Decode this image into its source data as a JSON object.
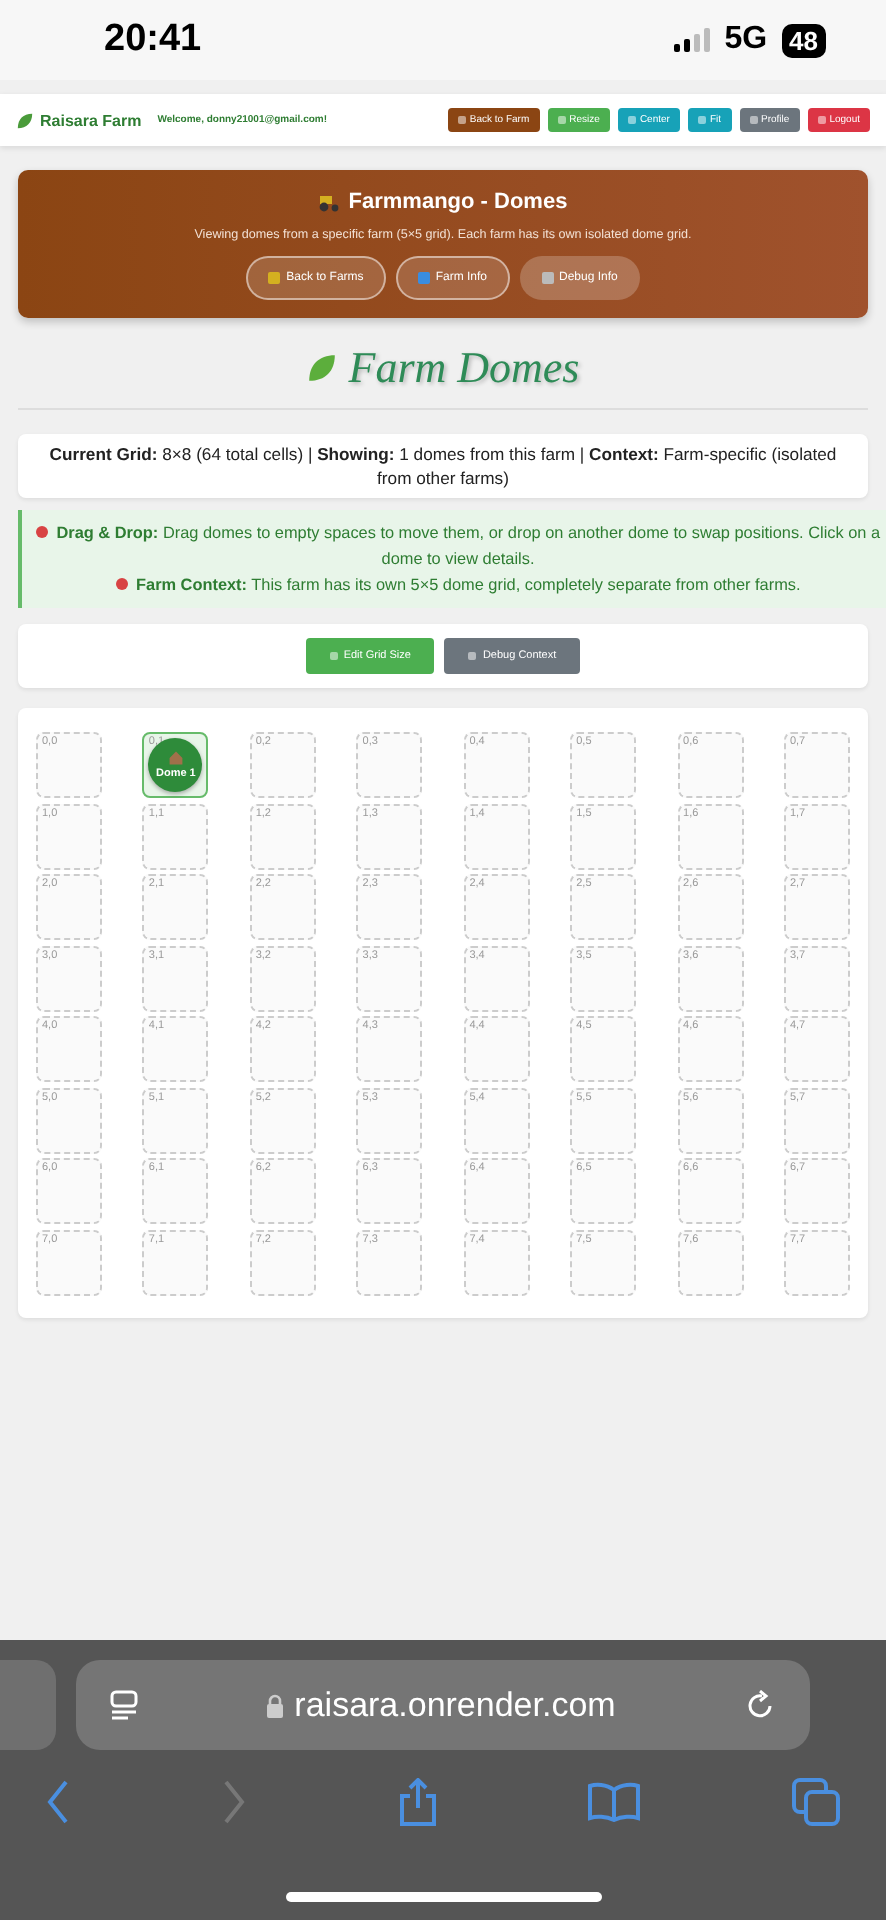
{
  "status_bar": {
    "time": "20:41",
    "network": "5G",
    "battery": "48"
  },
  "nav": {
    "brand": "Raisara Farm",
    "welcome": "Welcome, donny21001@gmail.com!",
    "buttons": [
      {
        "label": "Back to Farm",
        "kind": "brown"
      },
      {
        "label": "Resize",
        "kind": "green"
      },
      {
        "label": "Center",
        "kind": "teal"
      },
      {
        "label": "Fit",
        "kind": "teal"
      },
      {
        "label": "Profile",
        "kind": "grey"
      },
      {
        "label": "Logout",
        "kind": "red"
      }
    ]
  },
  "header": {
    "title": "Farmmango - Domes",
    "subtitle": "Viewing domes from a specific farm (5×5 grid). Each farm has its own isolated dome grid.",
    "buttons": [
      {
        "label": "Back to Farms"
      },
      {
        "label": "Farm Info"
      },
      {
        "label": "Debug Info"
      }
    ]
  },
  "page_title": "Farm Domes",
  "info": "**Current Grid:** 8×8 (64 total cells) | **Showing:** 1 domes from this farm | **Context:** Farm-specific (isolated from other farms)",
  "notes": [
    "**Drag & Drop:** Drag domes to empty spaces to move them, or drop on another dome to swap positions. Click on a dome to view details.",
    "**Farm Context:** This farm has its own 5×5 dome grid, completely separate from other farms."
  ],
  "actions": [
    {
      "label": "Edit Grid Size",
      "kind": "green"
    },
    {
      "label": "Debug Context",
      "kind": "grey"
    }
  ],
  "grid": {
    "rows": [
      [
        {
          "label": "0,0"
        },
        {
          "label": "0,1",
          "dome": "Dome 1"
        },
        {
          "label": "0,2"
        },
        {
          "label": "0,3"
        },
        {
          "label": "0,4"
        },
        {
          "label": "0,5"
        },
        {
          "label": "0,6"
        },
        {
          "label": "0,7"
        }
      ],
      [
        {
          "label": "1,0"
        },
        {
          "label": "1,1"
        },
        {
          "label": "1,2"
        },
        {
          "label": "1,3"
        },
        {
          "label": "1,4"
        },
        {
          "label": "1,5"
        },
        {
          "label": "1,6"
        },
        {
          "label": "1,7"
        }
      ],
      [
        {
          "label": "2,0"
        },
        {
          "label": "2,1"
        },
        {
          "label": "2,2"
        },
        {
          "label": "2,3"
        },
        {
          "label": "2,4"
        },
        {
          "label": "2,5"
        },
        {
          "label": "2,6"
        },
        {
          "label": "2,7"
        }
      ],
      [
        {
          "label": "3,0"
        },
        {
          "label": "3,1"
        },
        {
          "label": "3,2"
        },
        {
          "label": "3,3"
        },
        {
          "label": "3,4"
        },
        {
          "label": "3,5"
        },
        {
          "label": "3,6"
        },
        {
          "label": "3,7"
        }
      ],
      [
        {
          "label": "4,0"
        },
        {
          "label": "4,1"
        },
        {
          "label": "4,2"
        },
        {
          "label": "4,3"
        },
        {
          "label": "4,4"
        },
        {
          "label": "4,5"
        },
        {
          "label": "4,6"
        },
        {
          "label": "4,7"
        }
      ],
      [
        {
          "label": "5,0"
        },
        {
          "label": "5,1"
        },
        {
          "label": "5,2"
        },
        {
          "label": "5,3"
        },
        {
          "label": "5,4"
        },
        {
          "label": "5,5"
        },
        {
          "label": "5,6"
        },
        {
          "label": "5,7"
        }
      ],
      [
        {
          "label": "6,0"
        },
        {
          "label": "6,1"
        },
        {
          "label": "6,2"
        },
        {
          "label": "6,3"
        },
        {
          "label": "6,4"
        },
        {
          "label": "6,5"
        },
        {
          "label": "6,6"
        },
        {
          "label": "6,7"
        }
      ],
      [
        {
          "label": "7,0"
        },
        {
          "label": "7,1"
        },
        {
          "label": "7,2"
        },
        {
          "label": "7,3"
        },
        {
          "label": "7,4"
        },
        {
          "label": "7,5"
        },
        {
          "label": "7,6"
        },
        {
          "label": "7,7"
        }
      ]
    ]
  },
  "browser": {
    "url": "raisara.onrender.com"
  }
}
